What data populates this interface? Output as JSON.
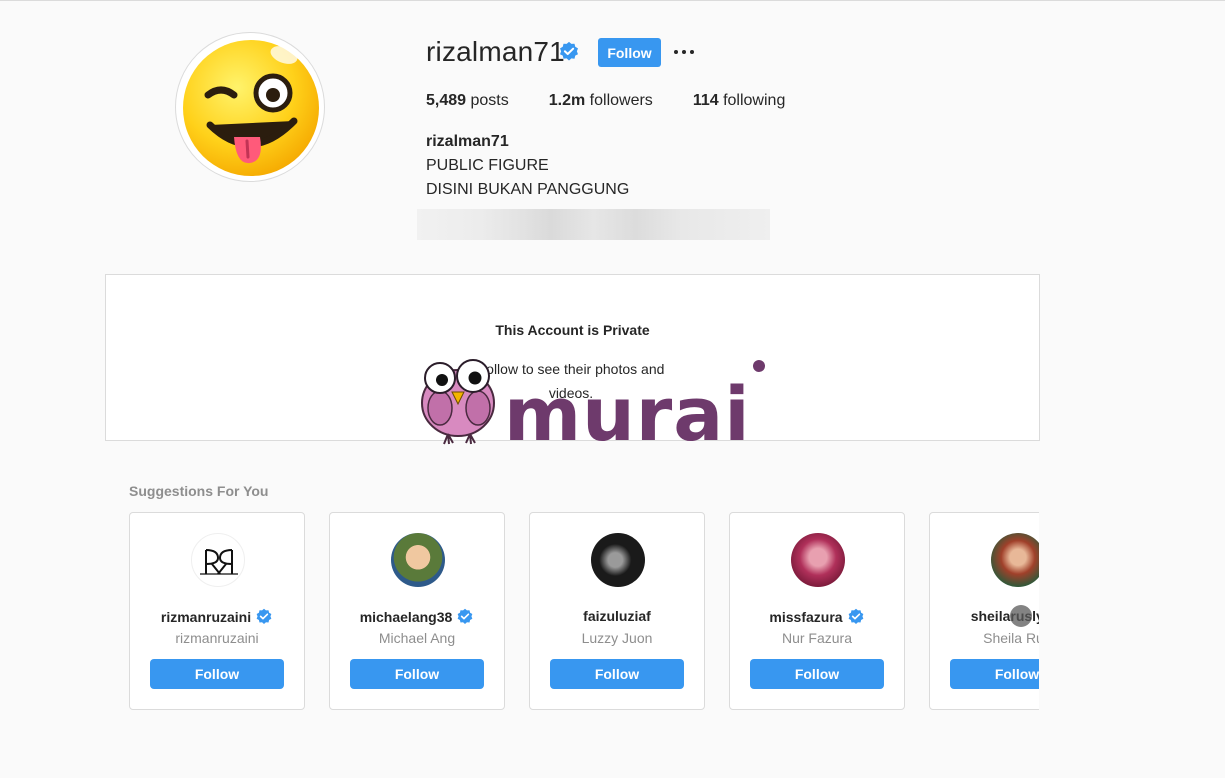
{
  "profile": {
    "username": "rizalman71",
    "follow_label": "Follow",
    "more_icon": "more-horizontal-icon",
    "stats": {
      "posts_count": "5,489",
      "posts_label": "posts",
      "followers_count": "1.2m",
      "followers_label": "followers",
      "following_count": "114",
      "following_label": "following"
    },
    "bio": {
      "name": "rizalman71",
      "line1": "PUBLIC FIGURE",
      "line2": "DISINI BUKAN PANGGUNG"
    }
  },
  "private_notice": {
    "title": "This Account is Private",
    "subtitle": "Follow to see their photos and videos."
  },
  "watermark": {
    "text": "murai"
  },
  "suggestions": {
    "heading": "Suggestions For You",
    "items": [
      {
        "username": "rizmanruzaini",
        "name": "rizmanruzaini",
        "verified": true,
        "follow_label": "Follow"
      },
      {
        "username": "michaelang38",
        "name": "Michael Ang",
        "verified": true,
        "follow_label": "Follow"
      },
      {
        "username": "faizuluziaf",
        "name": "Luzzy Juon",
        "verified": false,
        "follow_label": "Follow"
      },
      {
        "username": "missfazura",
        "name": "Nur Fazura",
        "verified": true,
        "follow_label": "Follow"
      },
      {
        "username": "sheilarusly_is",
        "name": "Sheila Rus",
        "verified": false,
        "follow_label": "Follow"
      }
    ]
  },
  "colors": {
    "accent_blue": "#3897f0",
    "verified_blue": "#3897f0",
    "watermark_purple": "#6e3a6c",
    "bird_pink": "#d88ac0"
  }
}
